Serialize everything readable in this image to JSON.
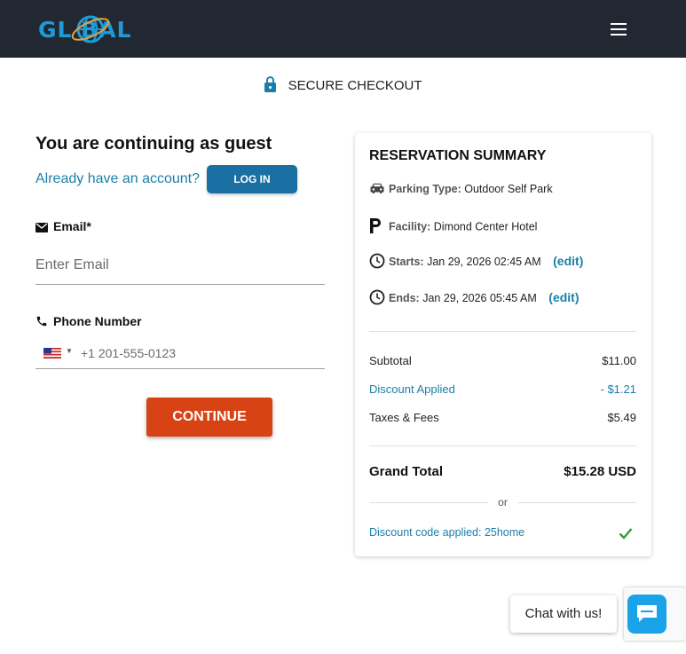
{
  "header": {
    "logo_text": "GL  BAL",
    "menu_icon": "hamburger-menu-icon",
    "bg_color": "#222831",
    "logo_color": "#1e9bd7"
  },
  "secure": {
    "label": "SECURE CHECKOUT",
    "icon": "lock-icon"
  },
  "guest": {
    "title": "You are continuing as guest",
    "have_account": "Already have an account?",
    "login_label": "LOG IN"
  },
  "email": {
    "label": "Email*",
    "icon": "mail-icon",
    "placeholder": "Enter Email",
    "value": ""
  },
  "phone": {
    "label": "Phone Number",
    "icon": "phone-icon",
    "country": "US",
    "placeholder": "+1 201-555-0123",
    "value": ""
  },
  "continue_label": "CONTINUE",
  "summary": {
    "title": "RESERVATION SUMMARY",
    "parking_type_label": "Parking Type:",
    "parking_type": "Outdoor Self Park",
    "facility_label": "Facility:",
    "facility": "Dimond Center Hotel",
    "starts_label": "Starts:",
    "starts": "Jan 29, 2026 02:45 AM",
    "ends_label": "Ends:",
    "ends": "Jan 29, 2026 05:45 AM",
    "edit_label": "(edit)",
    "subtotal_label": "Subtotal",
    "subtotal": "$11.00",
    "discount_label": "Discount Applied",
    "discount": "- $1.21",
    "taxes_label": "Taxes & Fees",
    "taxes": "$5.49",
    "grand_total_label": "Grand Total",
    "grand_total": "$15.28 USD",
    "or_label": "or",
    "code_applied": "Discount code applied: 25home"
  },
  "chat": {
    "label": "Chat with us!",
    "icon": "chat-icon"
  },
  "colors": {
    "accent_blue": "#1a6fa3",
    "link_blue": "#1a7fa8",
    "continue_orange": "#d84315",
    "success_green": "#2e9e3e"
  }
}
